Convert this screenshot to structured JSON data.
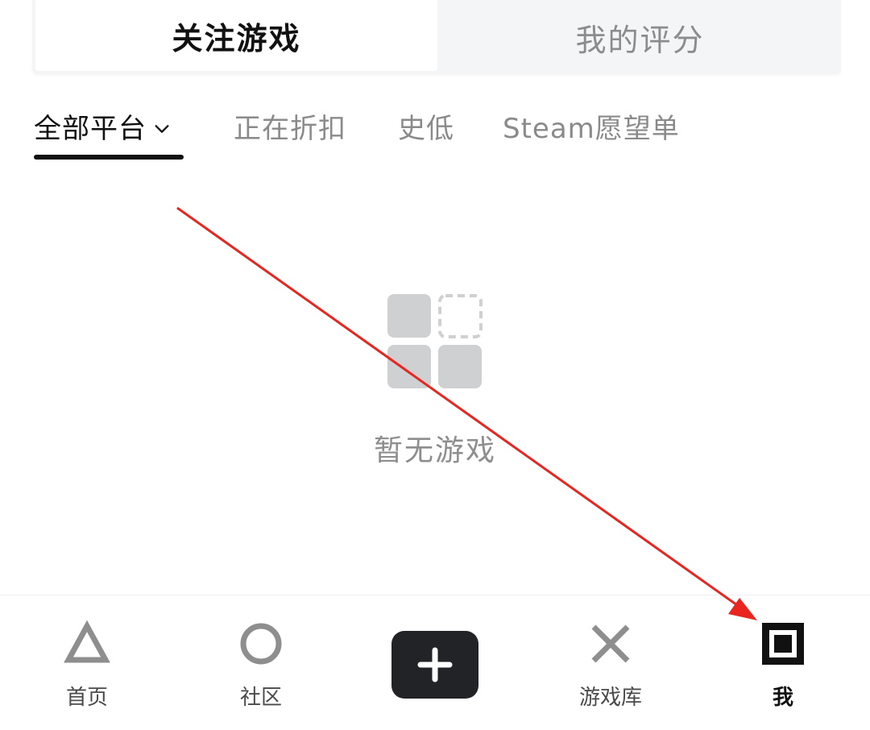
{
  "segmented_tabs": [
    {
      "label": "关注游戏",
      "active": true
    },
    {
      "label": "我的评分",
      "active": false
    }
  ],
  "filters": {
    "items": [
      {
        "label": "全部平台",
        "active": true,
        "has_dropdown": true
      },
      {
        "label": "正在折扣",
        "active": false
      },
      {
        "label": "史低",
        "active": false
      },
      {
        "label": "Steam愿望单",
        "active": false
      }
    ]
  },
  "empty_state": {
    "icon": "grid-placeholder-icon",
    "text": "暂无游戏"
  },
  "bottom_nav": {
    "items": [
      {
        "label": "首页",
        "icon": "triangle-icon"
      },
      {
        "label": "社区",
        "icon": "circle-icon"
      },
      {
        "label": "游戏库",
        "icon": "cross-icon"
      },
      {
        "label": "我",
        "icon": "square-icon",
        "active": true
      }
    ],
    "fab_icon": "plus-icon"
  },
  "colors": {
    "accent": "#111111",
    "inactive_text": "#8a8a8a",
    "icon_gray": "#8e8e8e",
    "placeholder_gray": "#cfd0d2",
    "fab_bg": "#222326",
    "annotation_arrow": "#e8261f"
  }
}
